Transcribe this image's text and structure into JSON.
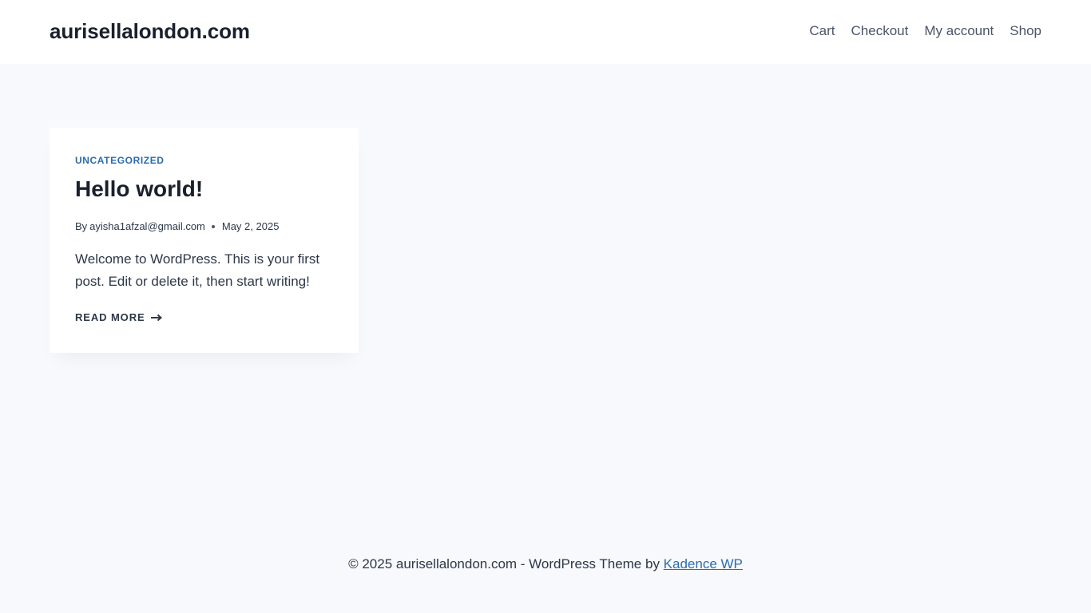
{
  "header": {
    "site_title": "aurisellalondon.com",
    "nav": [
      {
        "label": "Cart"
      },
      {
        "label": "Checkout"
      },
      {
        "label": "My account"
      },
      {
        "label": "Shop"
      }
    ]
  },
  "post": {
    "category": "UNCATEGORIZED",
    "title": "Hello world!",
    "by": "By",
    "author": "ayisha1afzal@gmail.com",
    "date": "May 2, 2025",
    "excerpt": "Welcome to WordPress. This is your first post. Edit or delete it, then start writing!",
    "read_more": "READ MORE",
    "read_more_icon": "arrow-right-icon"
  },
  "footer": {
    "text": "© 2025 aurisellalondon.com - WordPress Theme by ",
    "link_label": "Kadence WP"
  },
  "colors": {
    "background": "#f7f9fc",
    "card": "#ffffff",
    "accent": "#2b6cb0",
    "text": "#2d3748",
    "heading": "#1a202c"
  }
}
